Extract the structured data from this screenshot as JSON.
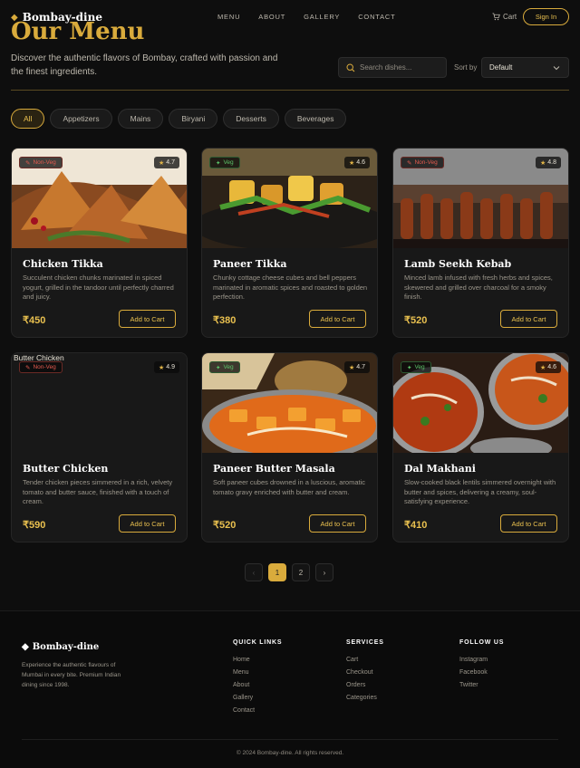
{
  "brand": {
    "name": "Bombay-dine"
  },
  "nav": [
    "MENU",
    "ABOUT",
    "GALLERY",
    "CONTACT"
  ],
  "header": {
    "cart_label": "Cart",
    "signin_label": "Sign In"
  },
  "page": {
    "title": "Our Menu",
    "intro": "Discover the authentic flavors of Bombay, crafted with passion and the finest ingredients."
  },
  "search": {
    "placeholder": "Search dishes..."
  },
  "sort": {
    "label": "Sort by",
    "value": "Default"
  },
  "filters": [
    "All",
    "Appetizers",
    "Mains",
    "Biryani",
    "Desserts",
    "Beverages"
  ],
  "currency": "₹",
  "add_to_cart_label": "Add to Cart",
  "dishes": [
    {
      "name": "Chicken Tikka",
      "desc": "Succulent chicken chunks marinated in spiced yogurt, grilled in the tandoor until perfectly charred and juicy.",
      "price": "₹450",
      "rating": "4.7",
      "type": "Non-Veg",
      "image": "samosa"
    },
    {
      "name": "Paneer Tikka",
      "desc": "Chunky cottage cheese cubes and bell peppers marinated in aromatic spices and roasted to golden perfection.",
      "price": "₹380",
      "rating": "4.6",
      "type": "Veg",
      "image": "paneer-skewers"
    },
    {
      "name": "Lamb Seekh Kebab",
      "desc": "Minced lamb infused with fresh herbs and spices, skewered and grilled over charcoal for a smoky finish.",
      "price": "₹520",
      "rating": "4.8",
      "type": "Non-Veg",
      "image": "kebab-skewers"
    },
    {
      "name": "Butter Chicken",
      "desc": "Tender chicken pieces simmered in a rich, velvety tomato and butter sauce, finished with a touch of cream.",
      "price": "₹590",
      "rating": "4.9",
      "type": "Non-Veg",
      "image": "broken",
      "alt": "Butter Chicken"
    },
    {
      "name": "Paneer Butter Masala",
      "desc": "Soft paneer cubes drowned in a luscious, aromatic tomato gravy enriched with butter and cream.",
      "price": "₹520",
      "rating": "4.7",
      "type": "Veg",
      "image": "curry-bowl"
    },
    {
      "name": "Dal Makhani",
      "desc": "Slow-cooked black lentils simmered overnight with butter and spices, delivering a creamy, soul-satisfying experience.",
      "price": "₹410",
      "rating": "4.6",
      "type": "Veg",
      "image": "curry-bowls"
    }
  ],
  "pagination": {
    "prev": "‹",
    "pages": [
      "1",
      "2"
    ],
    "current": "1",
    "next": "›"
  },
  "footer": {
    "brand": "Bombay-dine",
    "desc": "Experience the authentic flavours of Mumbai in every bite. Premium Indian dining since 1998.",
    "quick_links": {
      "title": "QUICK LINKS",
      "items": [
        "Home",
        "Menu",
        "About",
        "Gallery",
        "Contact"
      ]
    },
    "services": {
      "title": "SERVICES",
      "items": [
        "Cart",
        "Checkout",
        "Orders",
        "Categories"
      ]
    },
    "follow": {
      "title": "FOLLOW US",
      "items": [
        "Instagram",
        "Facebook",
        "Twitter"
      ]
    },
    "copyright": "© 2024 Bombay-dine. All rights reserved."
  },
  "colors": {
    "accent": "#d9ab3c",
    "veg": "#5cc46a",
    "nonveg": "#e55a4e",
    "background": "#0e0e0e"
  },
  "icons": {
    "brand": "diamond-icon",
    "cart": "cart-icon",
    "search": "search-icon",
    "sort": "chevron-down-icon",
    "rating": "star-icon",
    "type": "leaf-icon"
  }
}
